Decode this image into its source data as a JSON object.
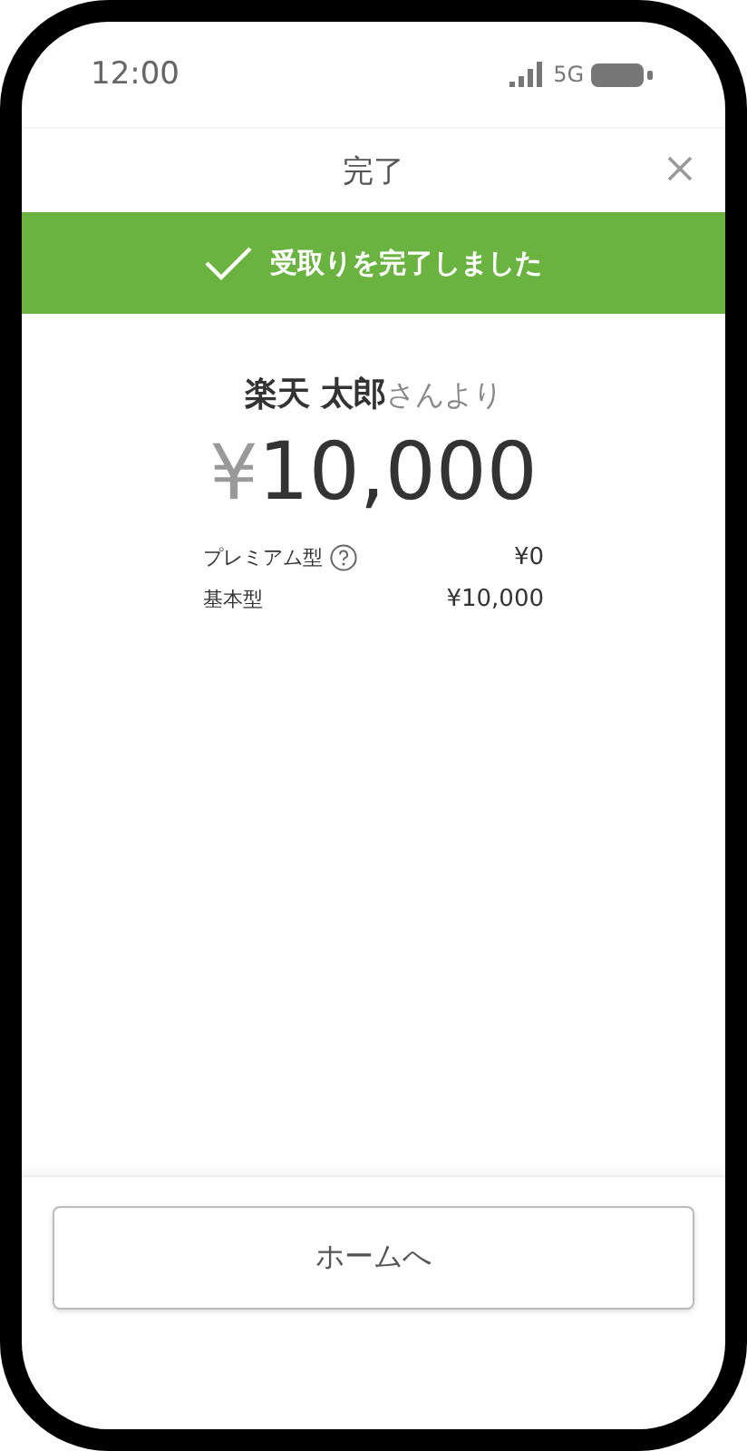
{
  "status_bar": {
    "time": "12:00",
    "network": "5G"
  },
  "header": {
    "title": "完了"
  },
  "banner": {
    "message": "受取りを完了しました"
  },
  "sender": {
    "name": "楽天 太郎",
    "suffix": "さんより"
  },
  "amount": {
    "currency": "¥",
    "value": "10,000"
  },
  "breakdown": [
    {
      "label": "プレミアム型",
      "help": true,
      "value": "¥0"
    },
    {
      "label": "基本型",
      "help": false,
      "value": "¥10,000"
    }
  ],
  "buttons": [
    "ホームへ"
  ]
}
